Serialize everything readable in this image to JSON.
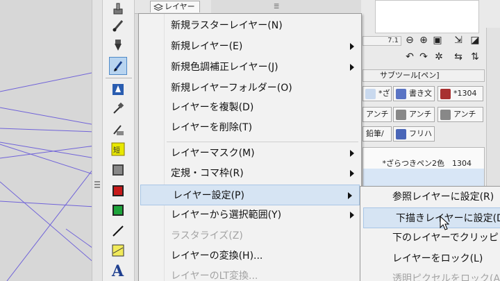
{
  "layer_tab": {
    "label": "レイヤー"
  },
  "brush_size": {
    "value": "7.1"
  },
  "subtool": {
    "header": "サブツール[ペン]",
    "chips": [
      "*ざらつ",
      "書き文",
      "*1304",
      "アンチ",
      "アンチ",
      "アンチ",
      "鉛筆/",
      "フリハ"
    ],
    "list_name": "*ざらつきペン2色　1304"
  },
  "menu": {
    "items": [
      {
        "label": "新規ラスターレイヤー(N)",
        "submenu": false,
        "enabled": true
      },
      {
        "label": "新規レイヤー(E)",
        "submenu": true,
        "enabled": true
      },
      {
        "label": "新規色調補正レイヤー(J)",
        "submenu": true,
        "enabled": true
      },
      {
        "label": "新規レイヤーフォルダー(O)",
        "submenu": false,
        "enabled": true
      },
      {
        "label": "レイヤーを複製(D)",
        "submenu": false,
        "enabled": true
      },
      {
        "label": "レイヤーを削除(T)",
        "submenu": false,
        "enabled": true
      },
      {
        "label": "レイヤーマスク(M)",
        "submenu": true,
        "enabled": true
      },
      {
        "label": "定規・コマ枠(R)",
        "submenu": true,
        "enabled": true
      },
      {
        "label": "レイヤー設定(P)",
        "submenu": true,
        "enabled": true,
        "highlighted": true
      },
      {
        "label": "レイヤーから選択範囲(Y)",
        "submenu": true,
        "enabled": true
      },
      {
        "label": "ラスタライズ(Z)",
        "submenu": false,
        "enabled": false
      },
      {
        "label": "レイヤーの変換(H)...",
        "submenu": false,
        "enabled": true
      },
      {
        "label": "レイヤーのLT変換...",
        "submenu": false,
        "enabled": false
      }
    ]
  },
  "submenu": {
    "items": [
      {
        "label": "参照レイヤーに設定(R)",
        "enabled": true
      },
      {
        "label": "下描きレイヤーに設定(D",
        "enabled": true,
        "highlighted": true
      },
      {
        "label": "下のレイヤーでクリッピ",
        "enabled": true
      },
      {
        "label": "レイヤーをロック(L)",
        "enabled": true
      },
      {
        "label": "透明ピクセルをロック(A",
        "enabled": false
      }
    ]
  },
  "colors": {
    "highlight": "#d6e4f3",
    "active_tool": "#b8d4f0",
    "canvas_lines": "#6a5acd"
  }
}
